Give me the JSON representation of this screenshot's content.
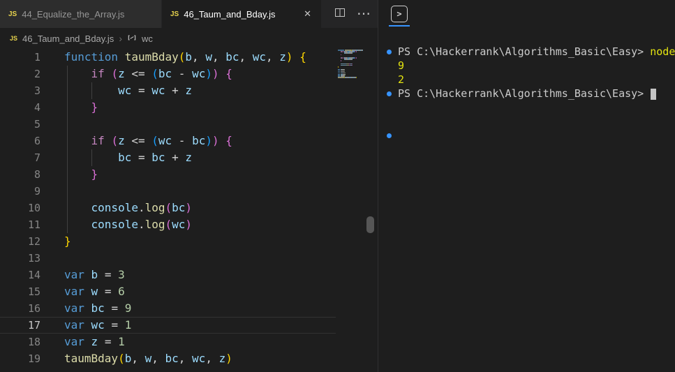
{
  "theme": {
    "bg": "#1e1e1e",
    "tabbar_bg": "#252526",
    "tab_inactive_bg": "#2d2d2d",
    "tab_active_bg": "#1e1e1e",
    "accent_blue": "#3794ff",
    "js_icon_yellow": "#e8d44d"
  },
  "icons": {
    "js_badge": "JS",
    "close": "✕",
    "more": "⋯",
    "chevron": "›",
    "terminal_panel": ">"
  },
  "tabs": [
    {
      "label": "44_Equalize_the_Array.js",
      "active": false
    },
    {
      "label": "46_Taum_and_Bday.js",
      "active": true
    }
  ],
  "breadcrumb": {
    "file": "46_Taum_and_Bday.js",
    "symbol": "wc"
  },
  "editor": {
    "current_line": 17,
    "colors": {
      "kw": "#569cd6",
      "ctl": "#c586c0",
      "fn": "#dcdcaa",
      "var": "#9cdcfe",
      "num": "#b5cea8",
      "op": "#d4d4d4",
      "txt": "#d4d4d4",
      "b1": "#ffd700",
      "b2": "#da70d6",
      "b3": "#179fff",
      "lineno": "#858585",
      "lineno_active": "#c6c6c6"
    },
    "lines": [
      [
        [
          "kw",
          "function"
        ],
        [
          "txt",
          " "
        ],
        [
          "fn",
          "taumBday"
        ],
        [
          "b1",
          "("
        ],
        [
          "var",
          "b"
        ],
        [
          "op",
          ", "
        ],
        [
          "var",
          "w"
        ],
        [
          "op",
          ", "
        ],
        [
          "var",
          "bc"
        ],
        [
          "op",
          ", "
        ],
        [
          "var",
          "wc"
        ],
        [
          "op",
          ", "
        ],
        [
          "var",
          "z"
        ],
        [
          "b1",
          ")"
        ],
        [
          "txt",
          " "
        ],
        [
          "b1",
          "{"
        ]
      ],
      [
        [
          "txt",
          "    "
        ],
        [
          "ctl",
          "if"
        ],
        [
          "txt",
          " "
        ],
        [
          "b2",
          "("
        ],
        [
          "var",
          "z"
        ],
        [
          "op",
          " <= "
        ],
        [
          "b3",
          "("
        ],
        [
          "var",
          "bc"
        ],
        [
          "op",
          " - "
        ],
        [
          "var",
          "wc"
        ],
        [
          "b3",
          ")"
        ],
        [
          "b2",
          ")"
        ],
        [
          "txt",
          " "
        ],
        [
          "b2",
          "{"
        ]
      ],
      [
        [
          "txt",
          "        "
        ],
        [
          "var",
          "wc"
        ],
        [
          "op",
          " = "
        ],
        [
          "var",
          "wc"
        ],
        [
          "op",
          " + "
        ],
        [
          "var",
          "z"
        ]
      ],
      [
        [
          "txt",
          "    "
        ],
        [
          "b2",
          "}"
        ]
      ],
      [],
      [
        [
          "txt",
          "    "
        ],
        [
          "ctl",
          "if"
        ],
        [
          "txt",
          " "
        ],
        [
          "b2",
          "("
        ],
        [
          "var",
          "z"
        ],
        [
          "op",
          " <= "
        ],
        [
          "b3",
          "("
        ],
        [
          "var",
          "wc"
        ],
        [
          "op",
          " - "
        ],
        [
          "var",
          "bc"
        ],
        [
          "b3",
          ")"
        ],
        [
          "b2",
          ")"
        ],
        [
          "txt",
          " "
        ],
        [
          "b2",
          "{"
        ]
      ],
      [
        [
          "txt",
          "        "
        ],
        [
          "var",
          "bc"
        ],
        [
          "op",
          " = "
        ],
        [
          "var",
          "bc"
        ],
        [
          "op",
          " + "
        ],
        [
          "var",
          "z"
        ]
      ],
      [
        [
          "txt",
          "    "
        ],
        [
          "b2",
          "}"
        ]
      ],
      [],
      [
        [
          "txt",
          "    "
        ],
        [
          "var",
          "console"
        ],
        [
          "op",
          "."
        ],
        [
          "fn",
          "log"
        ],
        [
          "b2",
          "("
        ],
        [
          "var",
          "bc"
        ],
        [
          "b2",
          ")"
        ]
      ],
      [
        [
          "txt",
          "    "
        ],
        [
          "var",
          "console"
        ],
        [
          "op",
          "."
        ],
        [
          "fn",
          "log"
        ],
        [
          "b2",
          "("
        ],
        [
          "var",
          "wc"
        ],
        [
          "b2",
          ")"
        ]
      ],
      [
        [
          "b1",
          "}"
        ]
      ],
      [],
      [
        [
          "kw",
          "var"
        ],
        [
          "txt",
          " "
        ],
        [
          "var",
          "b"
        ],
        [
          "op",
          " = "
        ],
        [
          "num",
          "3"
        ]
      ],
      [
        [
          "kw",
          "var"
        ],
        [
          "txt",
          " "
        ],
        [
          "var",
          "w"
        ],
        [
          "op",
          " = "
        ],
        [
          "num",
          "6"
        ]
      ],
      [
        [
          "kw",
          "var"
        ],
        [
          "txt",
          " "
        ],
        [
          "var",
          "bc"
        ],
        [
          "op",
          " = "
        ],
        [
          "num",
          "9"
        ]
      ],
      [
        [
          "kw",
          "var"
        ],
        [
          "txt",
          " "
        ],
        [
          "var",
          "wc"
        ],
        [
          "op",
          " = "
        ],
        [
          "num",
          "1"
        ]
      ],
      [
        [
          "kw",
          "var"
        ],
        [
          "txt",
          " "
        ],
        [
          "var",
          "z"
        ],
        [
          "op",
          " = "
        ],
        [
          "num",
          "1"
        ]
      ],
      [
        [
          "fn",
          "taumBday"
        ],
        [
          "b1",
          "("
        ],
        [
          "var",
          "b"
        ],
        [
          "op",
          ", "
        ],
        [
          "var",
          "w"
        ],
        [
          "op",
          ", "
        ],
        [
          "var",
          "bc"
        ],
        [
          "op",
          ", "
        ],
        [
          "var",
          "wc"
        ],
        [
          "op",
          ", "
        ],
        [
          "var",
          "z"
        ],
        [
          "b1",
          ")"
        ]
      ]
    ]
  },
  "terminal": {
    "colors": {
      "w": "#cccccc",
      "y": "#e5e510",
      "dot": "#3794ff"
    },
    "lines": [
      {
        "dot": true,
        "spans": [
          [
            "w",
            "PS C:\\Hackerrank\\Algorithms_Basic\\Easy> "
          ],
          [
            "y",
            "node"
          ]
        ]
      },
      {
        "dot": false,
        "spans": [
          [
            "y",
            "9"
          ]
        ]
      },
      {
        "dot": false,
        "spans": [
          [
            "y",
            "2"
          ]
        ]
      },
      {
        "dot": true,
        "cursor": true,
        "spans": [
          [
            "w",
            "PS C:\\Hackerrank\\Algorithms_Basic\\Easy> "
          ]
        ]
      },
      {
        "dot": false,
        "spans": []
      },
      {
        "dot": false,
        "spans": []
      },
      {
        "dot": true,
        "spans": []
      }
    ]
  }
}
